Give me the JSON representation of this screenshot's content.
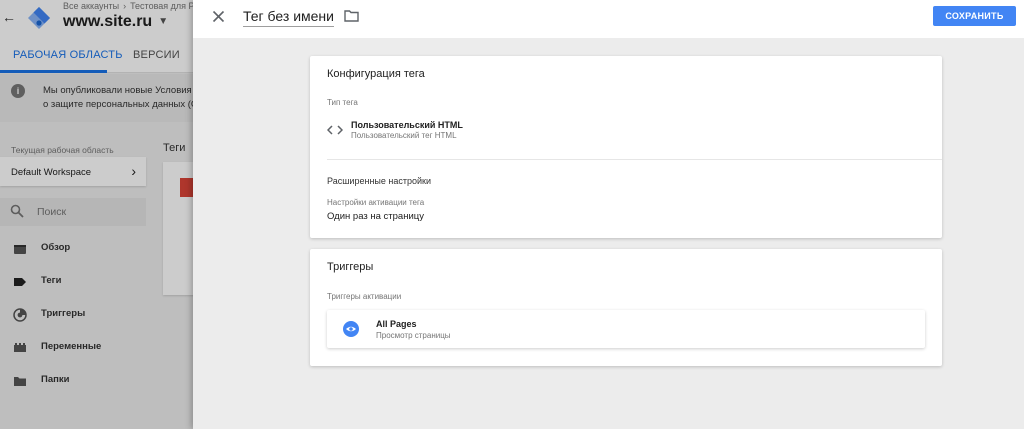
{
  "background": {
    "breadcrumbs": [
      "Все аккаунты",
      "Тестовая для РР"
    ],
    "container_name": "www.site.ru",
    "tabs": [
      {
        "label": "РАБОЧАЯ ОБЛАСТЬ"
      },
      {
        "label": "ВЕРСИИ"
      }
    ],
    "notice": {
      "line1": "Мы опубликовали новые Условия с",
      "line2": "о защите персональных данных (G"
    },
    "workspace": {
      "label": "Текущая рабочая область",
      "name": "Default Workspace"
    },
    "search_placeholder": "Поиск",
    "nav": [
      {
        "label": "Обзор",
        "icon": "overview-icon"
      },
      {
        "label": "Теги",
        "icon": "tag-icon"
      },
      {
        "label": "Триггеры",
        "icon": "trigger-icon"
      },
      {
        "label": "Переменные",
        "icon": "variables-icon"
      },
      {
        "label": "Папки",
        "icon": "folder-icon"
      }
    ],
    "tags_title": "Теги"
  },
  "panel": {
    "title": "Тег без имени",
    "save_label": "СОХРАНИТЬ",
    "config": {
      "title": "Конфигурация тега",
      "type_label": "Тип тега",
      "type_name": "Пользовательский HTML",
      "type_sub": "Пользовательский тег HTML",
      "advanced_title": "Расширенные настройки",
      "firing_label": "Настройки активации тега",
      "firing_value": "Один раз на страницу"
    },
    "triggers": {
      "title": "Триггеры",
      "label": "Триггеры активации",
      "items": [
        {
          "name": "All Pages",
          "type": "Просмотр страницы"
        }
      ]
    }
  },
  "colors": {
    "accent": "#4285f4",
    "tab_active": "#1a73e8",
    "tag_red": "#db4437"
  }
}
